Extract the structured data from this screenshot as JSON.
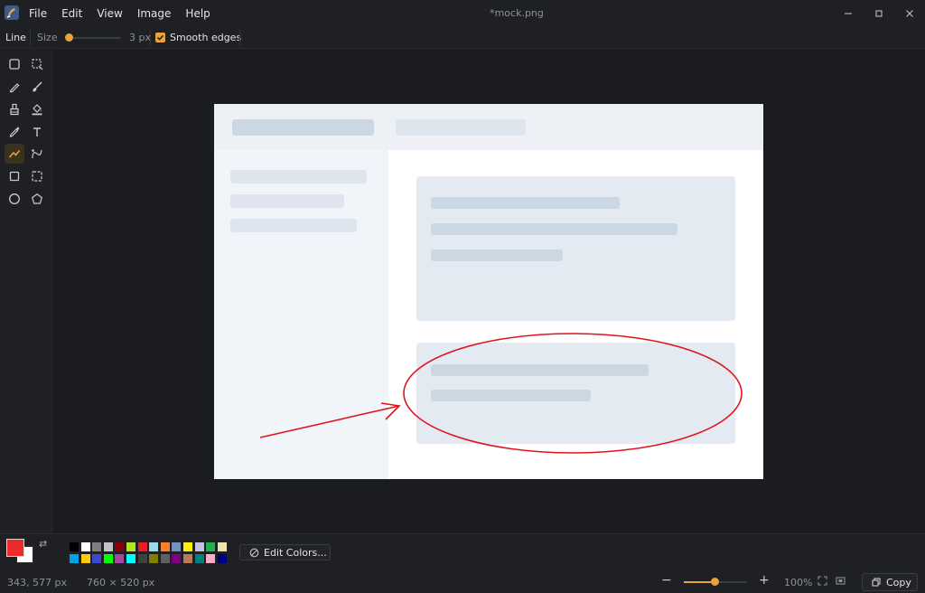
{
  "window": {
    "title": "*mock.png",
    "menus": [
      "File",
      "Edit",
      "View",
      "Image",
      "Help"
    ]
  },
  "options": {
    "tool_name": "Line",
    "size_label": "Size",
    "size_value": "3 px",
    "size_level": 0.05,
    "smooth_label": "Smooth edges",
    "smooth_checked": true
  },
  "tools": [
    {
      "icon": "rectangle-select-icon",
      "active": false
    },
    {
      "icon": "free-select-icon",
      "active": false
    },
    {
      "icon": "pencil-icon",
      "active": false
    },
    {
      "icon": "brush-icon",
      "active": false
    },
    {
      "icon": "eraser-icon",
      "active": false
    },
    {
      "icon": "fill-bucket-icon",
      "active": false
    },
    {
      "icon": "color-picker-icon",
      "active": false
    },
    {
      "icon": "text-icon",
      "active": false
    },
    {
      "icon": "line-icon",
      "active": true
    },
    {
      "icon": "curve-icon",
      "active": false
    },
    {
      "icon": "rectangle-icon",
      "active": false
    },
    {
      "icon": "rounded-rectangle-icon",
      "active": false
    },
    {
      "icon": "ellipse-icon",
      "active": false
    },
    {
      "icon": "polygon-icon",
      "active": false
    }
  ],
  "colors": {
    "accent": "#e8a33a",
    "primary": "#ee2b2b",
    "secondary": "#ffffff",
    "palette_row1": [
      "#000000",
      "#ffffff",
      "#7f7f7f",
      "#c3c3c3",
      "#880015",
      "#b5e61d",
      "#ed1c24",
      "#99d9ea",
      "#ff7f27",
      "#7092be",
      "#fff200",
      "#c8bfe7",
      "#22b14c",
      "#efe4b0"
    ],
    "palette_row2": [
      "#00a2e8",
      "#ffc90e",
      "#3f48cc",
      "#00ff00",
      "#a349a4",
      "#00ffff",
      "#404040",
      "#808000",
      "#606060",
      "#800080",
      "#b97a57",
      "#008080",
      "#ffaec9",
      "#000080"
    ]
  },
  "palette": {
    "edit_colors_label": "Edit Colors..."
  },
  "status": {
    "cursor_pos": "343, 577 px",
    "image_size": "760 × 520 px",
    "zoom_value": "100%",
    "zoom_level": 0.5,
    "copy_label": "Copy"
  }
}
